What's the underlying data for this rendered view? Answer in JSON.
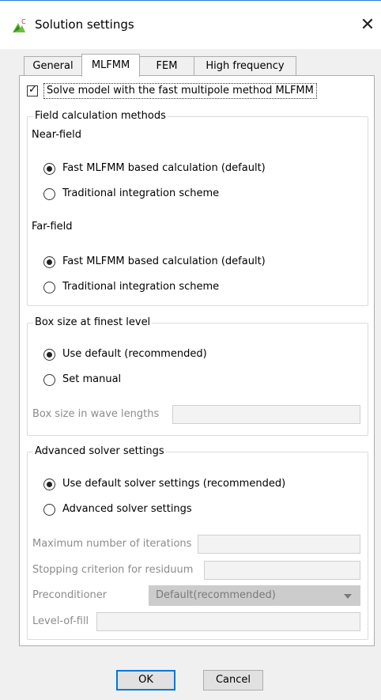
{
  "window": {
    "title": "Solution settings",
    "close_glyph": "✕",
    "app_icon": "cadfeko-icon"
  },
  "tabs": [
    {
      "label": "General",
      "active": false
    },
    {
      "label": "MLFMM",
      "active": true
    },
    {
      "label": "FEM",
      "active": false
    },
    {
      "label": "High frequency",
      "active": false
    }
  ],
  "mlfmm": {
    "solve_checkbox_label": "Solve model with the fast multipole method MLFMM",
    "solve_checked": true,
    "field_calc": {
      "title": "Field calculation methods",
      "near_field_label": "Near-field",
      "near_options": [
        "Fast MLFMM based calculation (default)",
        "Traditional integration scheme"
      ],
      "near_selected": 0,
      "far_field_label": "Far-field",
      "far_options": [
        "Fast MLFMM based calculation (default)",
        "Traditional integration scheme"
      ],
      "far_selected": 0
    },
    "box_size": {
      "title": "Box size at finest level",
      "options": [
        "Use default (recommended)",
        "Set manual"
      ],
      "selected": 0,
      "wave_lengths_label": "Box size in wave lengths",
      "wave_lengths_value": ""
    },
    "advanced": {
      "title": "Advanced solver settings",
      "options": [
        "Use default solver settings (recommended)",
        "Advanced solver settings"
      ],
      "selected": 0,
      "max_iterations_label": "Maximum number of iterations",
      "max_iterations_value": "",
      "stopping_label": "Stopping criterion for residuum",
      "stopping_value": "",
      "preconditioner_label": "Preconditioner",
      "preconditioner_value": "Default(recommended)",
      "level_of_fill_label": "Level-of-fill",
      "level_of_fill_value": ""
    }
  },
  "buttons": {
    "ok": "OK",
    "cancel": "Cancel"
  },
  "colors": {
    "accent": "#0078d7",
    "disabled_text": "#8c8c8c"
  }
}
